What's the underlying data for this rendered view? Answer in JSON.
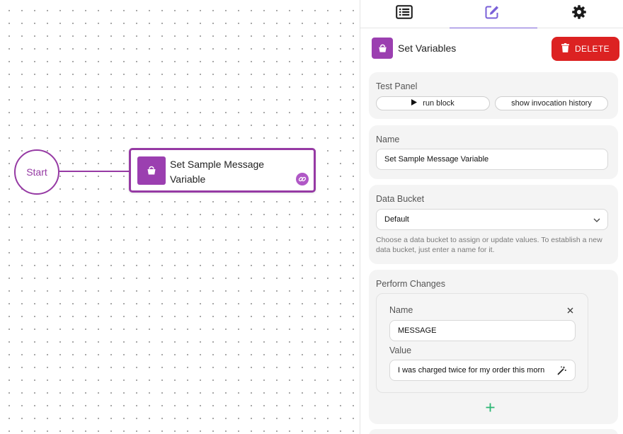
{
  "canvas": {
    "start_node": {
      "label": "Start"
    },
    "block_node": {
      "title": "Set Sample Message Variable",
      "icon": "bucket-icon",
      "badge_icon": "link-icon"
    }
  },
  "panel": {
    "tabs": [
      {
        "name": "list",
        "icon": "list-icon"
      },
      {
        "name": "edit",
        "icon": "edit-icon",
        "active": true
      },
      {
        "name": "settings",
        "icon": "gear-icon"
      }
    ],
    "header": {
      "title": "Set Variables",
      "icon": "bucket-icon",
      "delete_label": "DELETE"
    },
    "test_panel": {
      "label": "Test Panel",
      "run_label": "run block",
      "history_label": "show invocation history"
    },
    "name_section": {
      "label": "Name",
      "value": "Set Sample Message Variable"
    },
    "data_bucket": {
      "label": "Data Bucket",
      "selected": "Default",
      "helper": "Choose a data bucket to assign or update values. To establish a new data bucket, just enter a name for it."
    },
    "perform_changes": {
      "label": "Perform Changes",
      "items": [
        {
          "name_label": "Name",
          "name_value": "MESSAGE",
          "value_label": "Value",
          "value_value": "I was charged twice for my order this morn"
        }
      ]
    }
  },
  "colors": {
    "accent": "#963aa4",
    "delete": "#dc2222",
    "tab_indicator": "#7a60d8",
    "add": "#2bb673"
  }
}
